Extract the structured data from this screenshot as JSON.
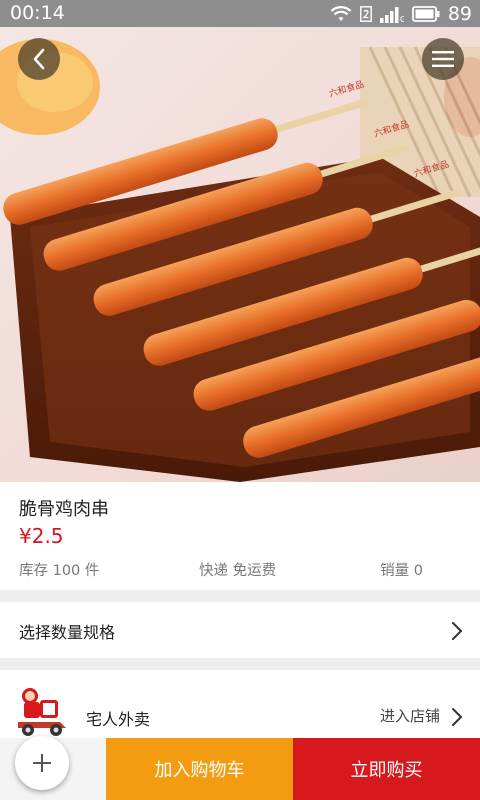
{
  "status_bar": {
    "time": "00:14",
    "battery": "89",
    "icons": [
      "wifi-icon",
      "sim-2-icon",
      "signal-icon",
      "battery-icon"
    ]
  },
  "header": {
    "back_icon": "chevron-left-icon",
    "menu_icon": "hamburger-menu-icon"
  },
  "hero": {
    "image": "grilled chicken skewers on a wooden tray",
    "skewer_tag": "六和食品"
  },
  "product": {
    "name": "脆骨鸡肉串",
    "price": "¥2.5",
    "stock": "库存 100 件",
    "shipping": "快递 免运费",
    "sales": "销量 0"
  },
  "spec": {
    "label": "选择数量规格",
    "icon": "chevron-right-icon"
  },
  "shop": {
    "name": "宅人外卖",
    "enter_label": "进入店铺",
    "logo_icon": "delivery-scooter-logo"
  },
  "bottom_bar": {
    "add_to_cart": "加入购物车",
    "buy_now": "立即购买",
    "fab_icon": "plus-icon"
  },
  "colors": {
    "price": "#d4161c",
    "cart_button": "#f39c12",
    "buy_button": "#d7181c",
    "status_bar": "#8e8e8e"
  }
}
